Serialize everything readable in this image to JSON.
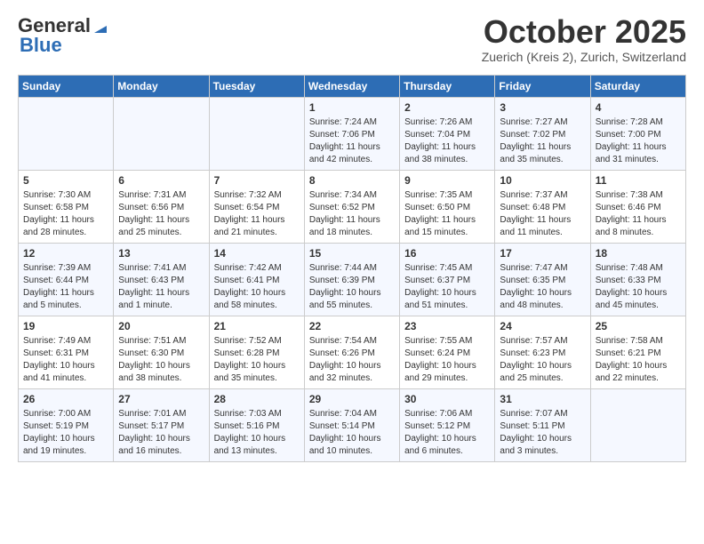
{
  "header": {
    "logo_line1": "General",
    "logo_line2": "Blue",
    "month": "October 2025",
    "location": "Zuerich (Kreis 2), Zurich, Switzerland"
  },
  "days_of_week": [
    "Sunday",
    "Monday",
    "Tuesday",
    "Wednesday",
    "Thursday",
    "Friday",
    "Saturday"
  ],
  "weeks": [
    [
      {
        "day": "",
        "info": ""
      },
      {
        "day": "",
        "info": ""
      },
      {
        "day": "",
        "info": ""
      },
      {
        "day": "1",
        "info": "Sunrise: 7:24 AM\nSunset: 7:06 PM\nDaylight: 11 hours\nand 42 minutes."
      },
      {
        "day": "2",
        "info": "Sunrise: 7:26 AM\nSunset: 7:04 PM\nDaylight: 11 hours\nand 38 minutes."
      },
      {
        "day": "3",
        "info": "Sunrise: 7:27 AM\nSunset: 7:02 PM\nDaylight: 11 hours\nand 35 minutes."
      },
      {
        "day": "4",
        "info": "Sunrise: 7:28 AM\nSunset: 7:00 PM\nDaylight: 11 hours\nand 31 minutes."
      }
    ],
    [
      {
        "day": "5",
        "info": "Sunrise: 7:30 AM\nSunset: 6:58 PM\nDaylight: 11 hours\nand 28 minutes."
      },
      {
        "day": "6",
        "info": "Sunrise: 7:31 AM\nSunset: 6:56 PM\nDaylight: 11 hours\nand 25 minutes."
      },
      {
        "day": "7",
        "info": "Sunrise: 7:32 AM\nSunset: 6:54 PM\nDaylight: 11 hours\nand 21 minutes."
      },
      {
        "day": "8",
        "info": "Sunrise: 7:34 AM\nSunset: 6:52 PM\nDaylight: 11 hours\nand 18 minutes."
      },
      {
        "day": "9",
        "info": "Sunrise: 7:35 AM\nSunset: 6:50 PM\nDaylight: 11 hours\nand 15 minutes."
      },
      {
        "day": "10",
        "info": "Sunrise: 7:37 AM\nSunset: 6:48 PM\nDaylight: 11 hours\nand 11 minutes."
      },
      {
        "day": "11",
        "info": "Sunrise: 7:38 AM\nSunset: 6:46 PM\nDaylight: 11 hours\nand 8 minutes."
      }
    ],
    [
      {
        "day": "12",
        "info": "Sunrise: 7:39 AM\nSunset: 6:44 PM\nDaylight: 11 hours\nand 5 minutes."
      },
      {
        "day": "13",
        "info": "Sunrise: 7:41 AM\nSunset: 6:43 PM\nDaylight: 11 hours\nand 1 minute."
      },
      {
        "day": "14",
        "info": "Sunrise: 7:42 AM\nSunset: 6:41 PM\nDaylight: 10 hours\nand 58 minutes."
      },
      {
        "day": "15",
        "info": "Sunrise: 7:44 AM\nSunset: 6:39 PM\nDaylight: 10 hours\nand 55 minutes."
      },
      {
        "day": "16",
        "info": "Sunrise: 7:45 AM\nSunset: 6:37 PM\nDaylight: 10 hours\nand 51 minutes."
      },
      {
        "day": "17",
        "info": "Sunrise: 7:47 AM\nSunset: 6:35 PM\nDaylight: 10 hours\nand 48 minutes."
      },
      {
        "day": "18",
        "info": "Sunrise: 7:48 AM\nSunset: 6:33 PM\nDaylight: 10 hours\nand 45 minutes."
      }
    ],
    [
      {
        "day": "19",
        "info": "Sunrise: 7:49 AM\nSunset: 6:31 PM\nDaylight: 10 hours\nand 41 minutes."
      },
      {
        "day": "20",
        "info": "Sunrise: 7:51 AM\nSunset: 6:30 PM\nDaylight: 10 hours\nand 38 minutes."
      },
      {
        "day": "21",
        "info": "Sunrise: 7:52 AM\nSunset: 6:28 PM\nDaylight: 10 hours\nand 35 minutes."
      },
      {
        "day": "22",
        "info": "Sunrise: 7:54 AM\nSunset: 6:26 PM\nDaylight: 10 hours\nand 32 minutes."
      },
      {
        "day": "23",
        "info": "Sunrise: 7:55 AM\nSunset: 6:24 PM\nDaylight: 10 hours\nand 29 minutes."
      },
      {
        "day": "24",
        "info": "Sunrise: 7:57 AM\nSunset: 6:23 PM\nDaylight: 10 hours\nand 25 minutes."
      },
      {
        "day": "25",
        "info": "Sunrise: 7:58 AM\nSunset: 6:21 PM\nDaylight: 10 hours\nand 22 minutes."
      }
    ],
    [
      {
        "day": "26",
        "info": "Sunrise: 7:00 AM\nSunset: 5:19 PM\nDaylight: 10 hours\nand 19 minutes."
      },
      {
        "day": "27",
        "info": "Sunrise: 7:01 AM\nSunset: 5:17 PM\nDaylight: 10 hours\nand 16 minutes."
      },
      {
        "day": "28",
        "info": "Sunrise: 7:03 AM\nSunset: 5:16 PM\nDaylight: 10 hours\nand 13 minutes."
      },
      {
        "day": "29",
        "info": "Sunrise: 7:04 AM\nSunset: 5:14 PM\nDaylight: 10 hours\nand 10 minutes."
      },
      {
        "day": "30",
        "info": "Sunrise: 7:06 AM\nSunset: 5:12 PM\nDaylight: 10 hours\nand 6 minutes."
      },
      {
        "day": "31",
        "info": "Sunrise: 7:07 AM\nSunset: 5:11 PM\nDaylight: 10 hours\nand 3 minutes."
      },
      {
        "day": "",
        "info": ""
      }
    ]
  ]
}
